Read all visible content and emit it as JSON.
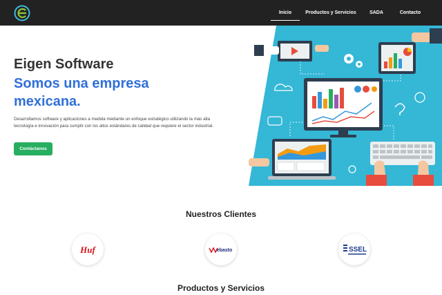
{
  "nav": {
    "logo_icon": "eigen-logo-icon",
    "items": [
      {
        "label": "Inicio",
        "active": true
      },
      {
        "label": "Productos y Servicios",
        "active": false
      },
      {
        "label": "SADA",
        "active": false
      },
      {
        "label": "Contacto",
        "active": false
      }
    ]
  },
  "hero": {
    "title": "Eigen Software",
    "subtitle": "Somos una empresa mexicana.",
    "description": "Desarrollamos software y aplicaciones a medida mediante un enfoque estratégico utilizando la más alta tecnología e innovación para cumplir con los altos estándares de calidad que requiere el sector industrial.",
    "cta_label": "Contáctanos"
  },
  "clients": {
    "title": "Nuestros Clientes",
    "logos": [
      {
        "name": "Huf",
        "color": "#d6101a"
      },
      {
        "name": "Webasto",
        "color": "#1a2a7a"
      },
      {
        "name": "SSEL",
        "color": "#1a3a8a"
      }
    ]
  },
  "products": {
    "title": "Productos y Servicios"
  },
  "colors": {
    "navbar": "#222222",
    "accent_blue": "#2f6fd8",
    "cta_green": "#27ae60",
    "illustration_bg": "#35b7d6"
  }
}
